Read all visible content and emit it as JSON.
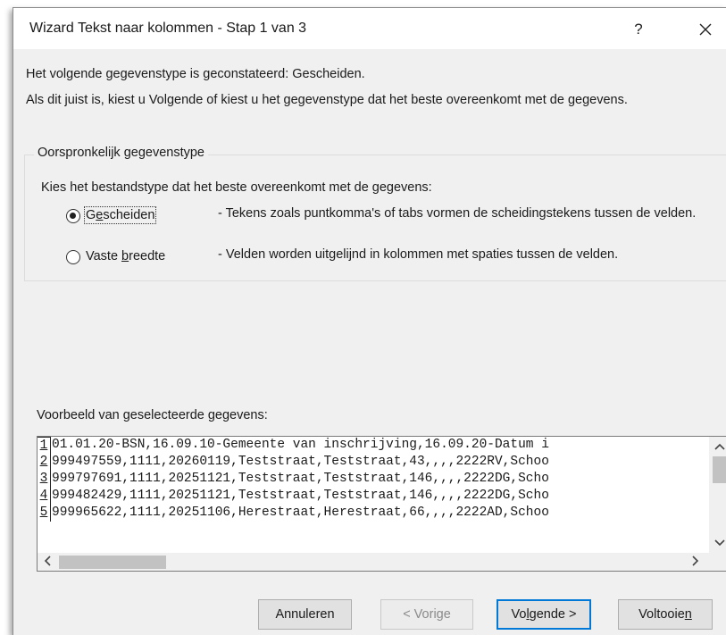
{
  "window": {
    "title": "Wizard Tekst naar kolommen - Stap 1 van 3",
    "help": "?"
  },
  "detected_text": "Het volgende gegevenstype is geconstateerd: Gescheiden.",
  "instruction_text": "Als dit juist is, kiest u Volgende of kiest u het gegevenstype dat het beste overeenkomt met de gegevens.",
  "group": {
    "legend": "Oorspronkelijk gegevenstype",
    "prompt": "Kies het bestandstype dat het beste overeenkomt met de gegevens:",
    "options": [
      {
        "label_pre": "G",
        "label_mnemonic": "e",
        "label_post": "scheiden",
        "description": "- Tekens zoals puntkomma's of tabs vormen de scheidingstekens tussen de velden.",
        "selected": true
      },
      {
        "label_pre": "Vaste ",
        "label_mnemonic": "b",
        "label_post": "reedte",
        "description": "- Velden worden uitgelijnd in kolommen met spaties tussen de velden.",
        "selected": false
      }
    ]
  },
  "preview": {
    "label": "Voorbeeld van geselecteerde gegevens:",
    "lines": [
      {
        "num": "1",
        "text": "01.01.20-BSN,16.09.10-Gemeente van inschrijving,16.09.20-Datum i"
      },
      {
        "num": "2",
        "text": "999497559,1111,20260119,Teststraat,Teststraat,43,,,,2222RV,Schoo"
      },
      {
        "num": "3",
        "text": "999797691,1111,20251121,Teststraat,Teststraat,146,,,,2222DG,Scho"
      },
      {
        "num": "4",
        "text": "999482429,1111,20251121,Teststraat,Teststraat,146,,,,2222DG,Scho"
      },
      {
        "num": "5",
        "text": "999965622,1111,20251106,Herestraat,Herestraat,66,,,,2222AD,Schoo"
      }
    ]
  },
  "buttons": {
    "cancel": "Annuleren",
    "back": "< Vorige",
    "next_pre": "Vo",
    "next_mnemonic": "l",
    "next_post": "gende >",
    "finish_pre": "Voltooie",
    "finish_mnemonic": "n",
    "finish_post": ""
  }
}
